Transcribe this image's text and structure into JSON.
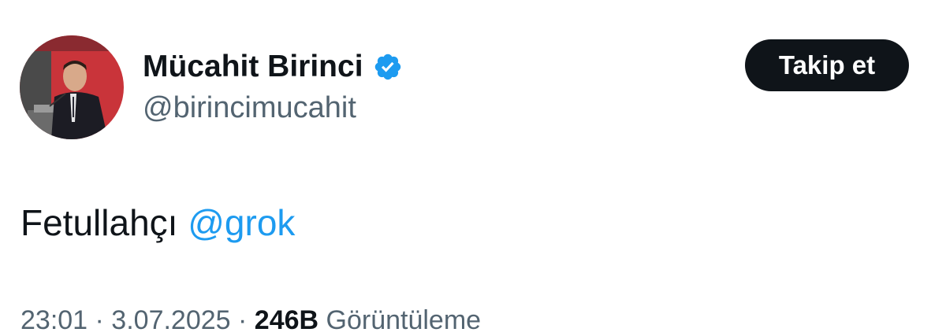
{
  "author": {
    "display_name": "Mücahit Birinci",
    "handle": "@birincimucahit",
    "verified_icon": "verified-badge-icon",
    "verified_color": "#1d9bf0"
  },
  "actions": {
    "follow_label": "Takip et"
  },
  "tweet": {
    "text": "Fetullahçı",
    "mention": "@grok"
  },
  "meta": {
    "timestamp": "23:01 · 3.07.2025",
    "separator": "·",
    "views_count": "246B",
    "views_label": "Görüntüleme"
  },
  "colors": {
    "text": "#0f1419",
    "secondary": "#536471",
    "link": "#1d9bf0",
    "button_bg": "#0f1419"
  }
}
